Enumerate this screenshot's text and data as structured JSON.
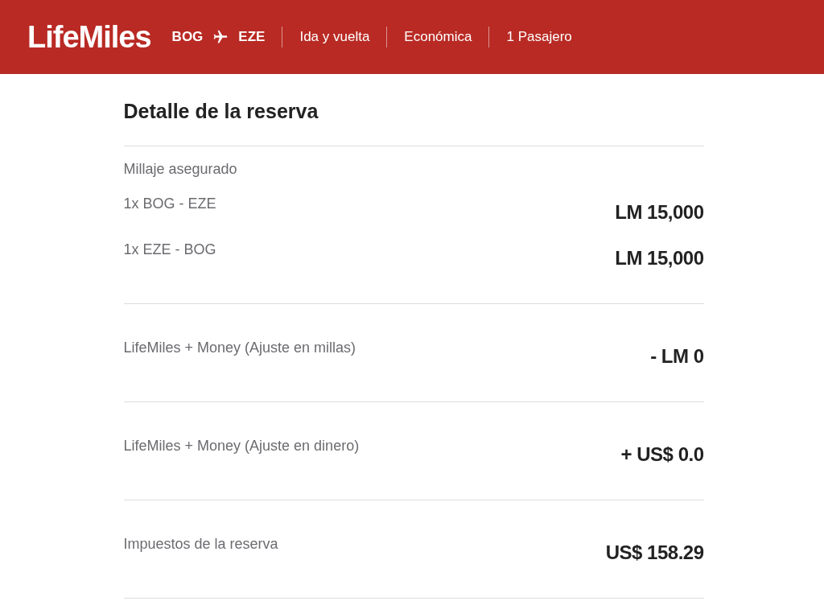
{
  "header": {
    "logo": "LifeMiles",
    "origin": "BOG",
    "destination": "EZE",
    "details": [
      "Ida y vuelta",
      "Económica",
      "1 Pasajero"
    ]
  },
  "title": "Detalle de la reserva",
  "sections": [
    {
      "heading": "Millaje asegurado",
      "rows": [
        {
          "label": "1x BOG - EZE",
          "amount": "LM 15,000"
        },
        {
          "label": "1x EZE - BOG",
          "amount": "LM 15,000"
        }
      ]
    },
    {
      "rows": [
        {
          "label": "LifeMiles + Money (Ajuste en millas)",
          "amount": "- LM 0"
        }
      ]
    },
    {
      "rows": [
        {
          "label": "LifeMiles + Money (Ajuste en dinero)",
          "amount": "+ US$ 0.0"
        }
      ]
    },
    {
      "rows": [
        {
          "label": "Impuestos de la reserva",
          "amount": "US$ 158.29"
        }
      ]
    }
  ]
}
